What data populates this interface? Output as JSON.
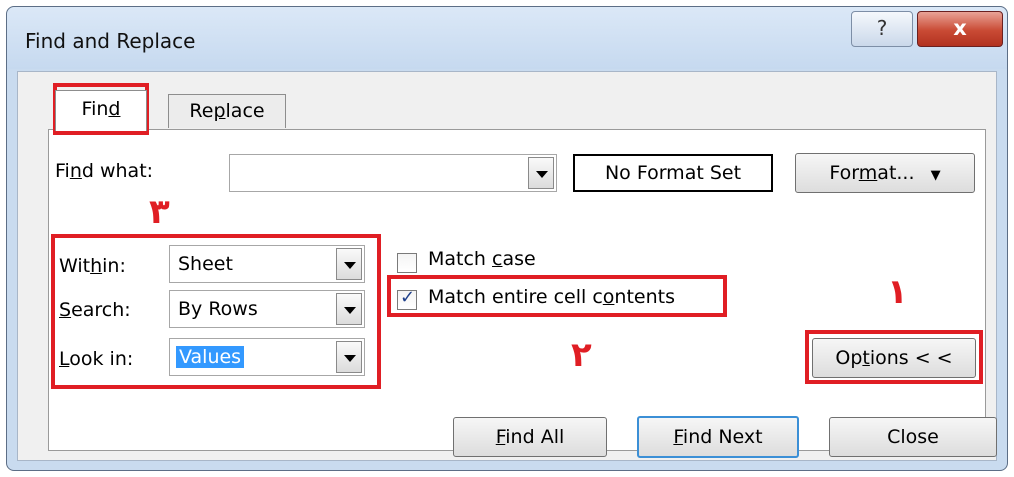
{
  "window": {
    "title": "Find and Replace",
    "help_icon": "?",
    "close_icon": "x"
  },
  "tabs": {
    "find": {
      "pre": "Fin",
      "u": "d",
      "post": ""
    },
    "replace": {
      "pre": "Re",
      "u": "p",
      "post": "lace"
    }
  },
  "find_what": {
    "label_pre": "Fi",
    "label_u": "n",
    "label_post": "d what:",
    "value": "",
    "format_status": "No Format Set",
    "format_button": {
      "pre": "For",
      "u": "m",
      "post": "at..."
    }
  },
  "options": {
    "within": {
      "label_pre": "Wit",
      "label_u": "h",
      "label_post": "in:",
      "value": "Sheet"
    },
    "search": {
      "label_pre": "",
      "label_u": "S",
      "label_post": "earch:",
      "value": "By Rows"
    },
    "look_in": {
      "label_pre": "",
      "label_u": "L",
      "label_post": "ook in:",
      "value": "Values"
    },
    "match_case": {
      "label_pre": "Match ",
      "label_u": "c",
      "label_post": "ase",
      "checked": false
    },
    "match_entire": {
      "label_pre": "Match entire cell c",
      "label_u": "o",
      "label_post": "ntents",
      "checked": true
    },
    "options_button": {
      "pre": "Op",
      "u": "t",
      "post": "ions < <"
    }
  },
  "buttons": {
    "find_all": {
      "pre": "",
      "u": "F",
      "post": "ind All"
    },
    "find_next": {
      "pre": "",
      "u": "F",
      "post": "ind Next"
    },
    "close": "Close"
  },
  "annotations": {
    "one": "١",
    "two": "٢",
    "three": "٣"
  },
  "colors": {
    "highlight": "#e01e24",
    "selection": "#3399ff",
    "default_button_border": "#3b8fd6"
  }
}
